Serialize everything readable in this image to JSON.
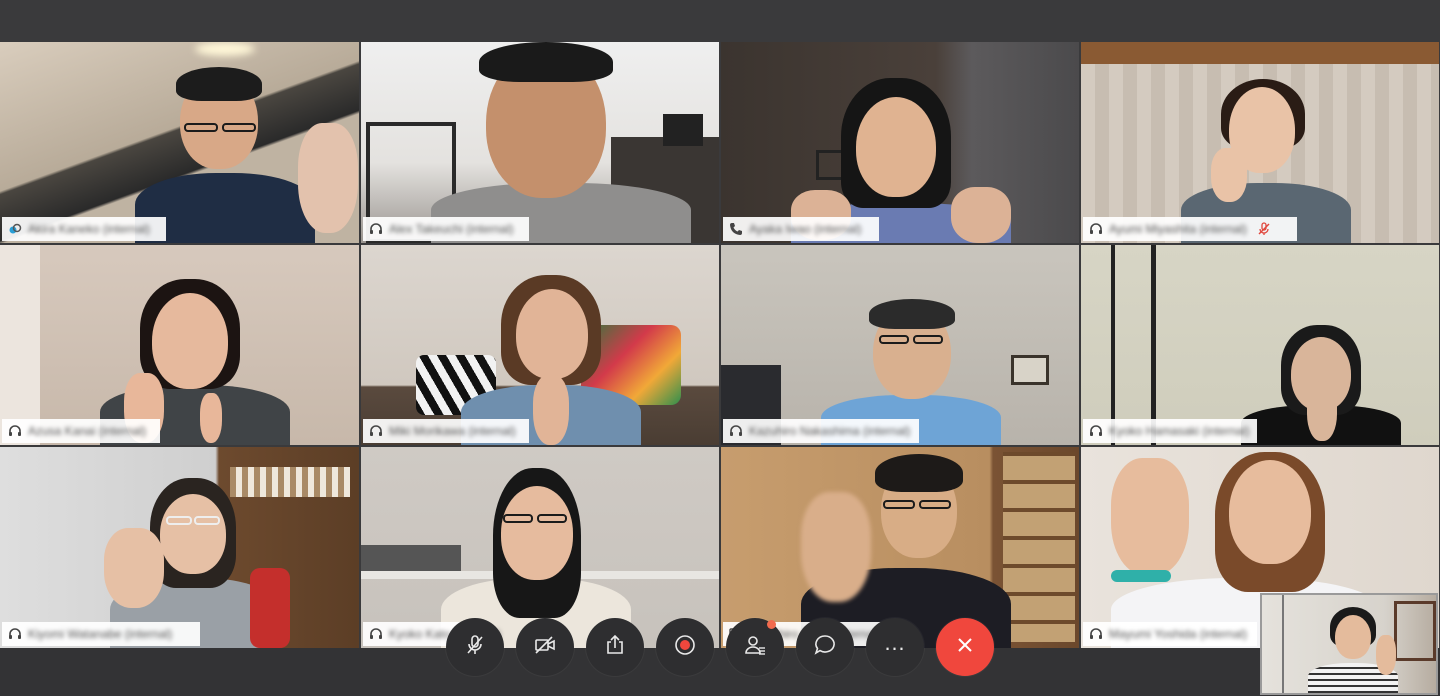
{
  "window": {
    "title": ""
  },
  "participants": [
    {
      "name": "Akira Kaneko (internal)",
      "audio": "headset",
      "active": false
    },
    {
      "name": "Alex Takeuchi (internal)",
      "audio": "headset",
      "active": false
    },
    {
      "name": "Ayaka Iwao (internal)",
      "audio": "phone",
      "active": true
    },
    {
      "name": "Ayumi Miyashita (internal)",
      "audio": "headset",
      "active": false,
      "muted": true
    },
    {
      "name": "Azusa Kanai (internal)",
      "audio": "headset",
      "active": false
    },
    {
      "name": "Miki Morikawa (internal)",
      "audio": "headset",
      "active": false
    },
    {
      "name": "Kazuhiro Nakashima (internal)",
      "audio": "headset",
      "active": false
    },
    {
      "name": "Kyoko Hamasaki (internal)",
      "audio": "headset",
      "active": false
    },
    {
      "name": "Kiyomi Watanabe (internal)",
      "audio": "headset",
      "active": false
    },
    {
      "name": "Kyoko Kato (internal)",
      "audio": "headset",
      "active": false
    },
    {
      "name": "Masahiro Sano (internal)",
      "audio": "computer",
      "active": true
    },
    {
      "name": "Mayumi Yoshida (internal)",
      "audio": "headset",
      "active": false
    }
  ],
  "controls": [
    {
      "icon": "mic-muted-icon",
      "label": "Unmute"
    },
    {
      "icon": "video-off-icon",
      "label": "Start video"
    },
    {
      "icon": "share-icon",
      "label": "Share"
    },
    {
      "icon": "record-icon",
      "label": "Record"
    },
    {
      "icon": "participants-icon",
      "label": "Participants"
    },
    {
      "icon": "chat-icon",
      "label": "Chat"
    },
    {
      "icon": "more-icon",
      "label": "More options"
    },
    {
      "icon": "close-icon",
      "label": "Leave meeting"
    }
  ],
  "colors": {
    "active_border": "#1aa8e0",
    "end_button": "#f0473d",
    "control_bg": "#2e2e30",
    "background": "#3a3a3c",
    "notification": "#f26a4d"
  }
}
